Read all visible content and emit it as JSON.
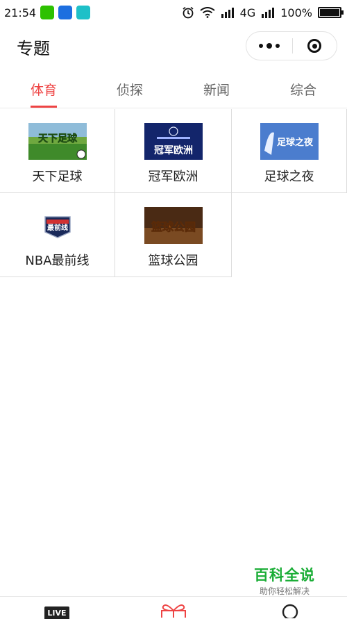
{
  "status_bar": {
    "time": "21:54",
    "network": "4G",
    "battery": "100%"
  },
  "nav": {
    "title": "专题"
  },
  "tabs": [
    {
      "label": "体育",
      "active": true
    },
    {
      "label": "侦探",
      "active": false
    },
    {
      "label": "新闻",
      "active": false
    },
    {
      "label": "综合",
      "active": false
    }
  ],
  "grid_items": [
    {
      "label": "天下足球",
      "thumb_text": "天下足球"
    },
    {
      "label": "冠军欧洲",
      "thumb_text": "冠军欧洲"
    },
    {
      "label": "足球之夜",
      "thumb_text": "足球之夜"
    },
    {
      "label": "NBA最前线",
      "thumb_text": "最前线"
    },
    {
      "label": "篮球公园",
      "thumb_text": "篮球公园"
    }
  ],
  "watermark": {
    "title": "百科全说",
    "subtitle": "助你轻松解决"
  },
  "tabbar": {
    "live_label": "LIVE"
  },
  "colors": {
    "accent": "#ee4444",
    "watermark_green": "#1aad36"
  }
}
